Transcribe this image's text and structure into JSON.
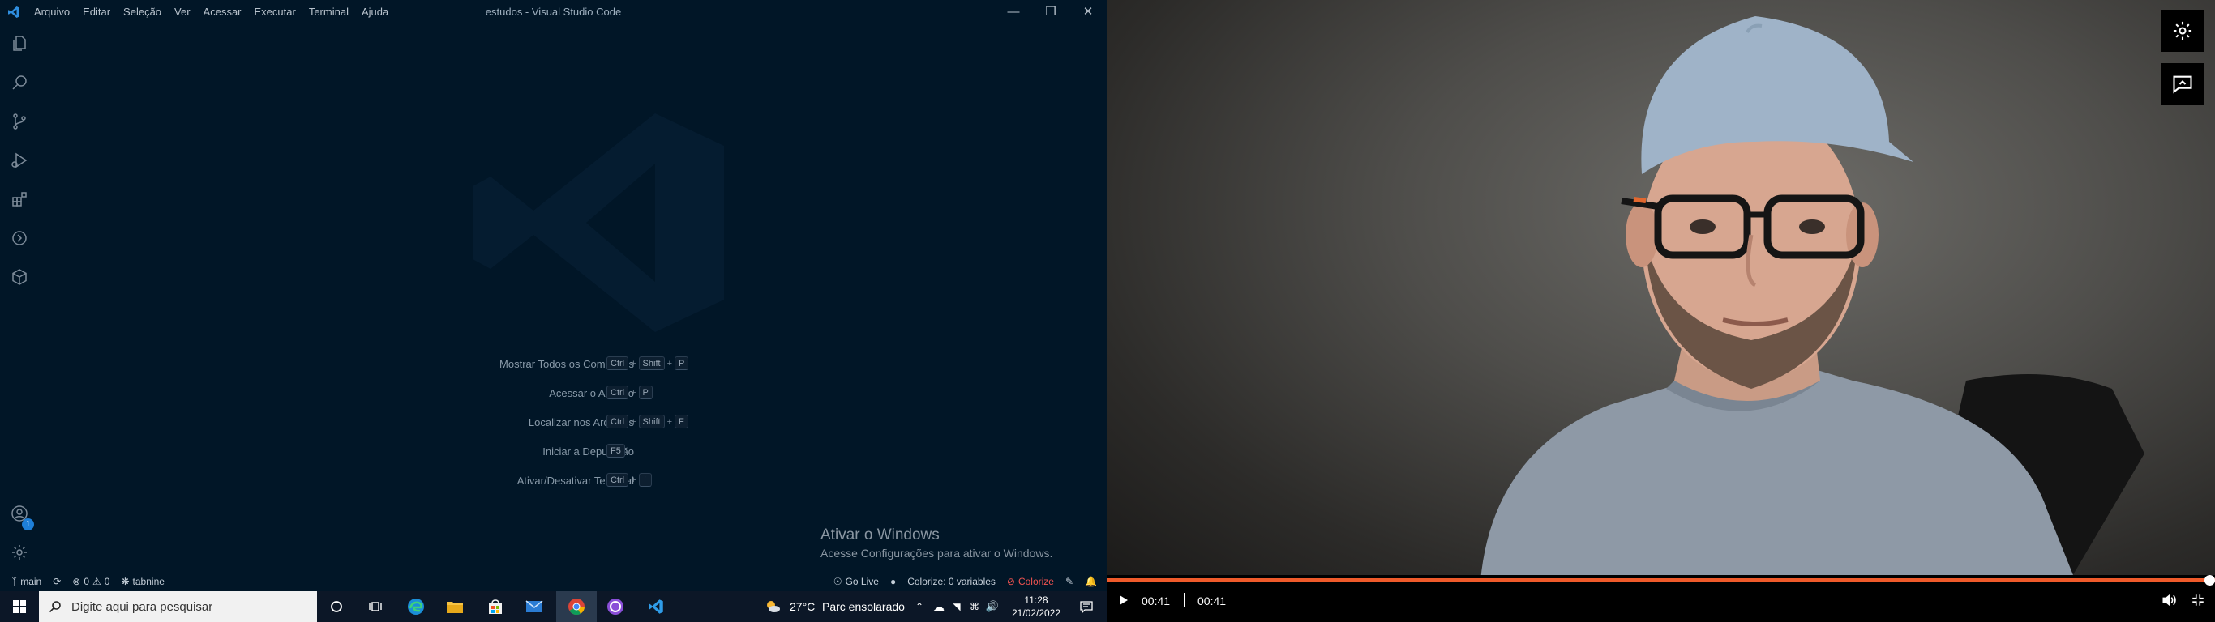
{
  "vscode": {
    "title_bar": {
      "menu": [
        "Arquivo",
        "Editar",
        "Seleção",
        "Ver",
        "Acessar",
        "Executar",
        "Terminal",
        "Ajuda"
      ],
      "window_title": "estudos - Visual Studio Code"
    },
    "activity_bar": {
      "icons": [
        "explorer-icon",
        "search-icon",
        "source-control-icon",
        "run-debug-icon",
        "extensions-icon",
        "remote-explorer-icon",
        "docker-icon",
        "account-icon",
        "settings-gear-icon"
      ],
      "account_badge": "1"
    },
    "shortcuts": [
      {
        "label": "Mostrar Todos os Comandos",
        "keys": [
          "Ctrl",
          "Shift",
          "P"
        ]
      },
      {
        "label": "Acessar o Arquivo",
        "keys": [
          "Ctrl",
          "P"
        ]
      },
      {
        "label": "Localizar nos Arquivos",
        "keys": [
          "Ctrl",
          "Shift",
          "F"
        ]
      },
      {
        "label": "Iniciar a Depuração",
        "keys": [
          "F5"
        ]
      },
      {
        "label": "Ativar/Desativar Terminal",
        "keys": [
          "Ctrl",
          "'"
        ]
      }
    ],
    "activation": {
      "title": "Ativar o Windows",
      "subtitle": "Acesse Configurações para ativar o Windows."
    },
    "status_bar": {
      "branch": "main",
      "errors": "0",
      "warnings": "0",
      "tabnine": "tabnine",
      "go_live": "Go Live",
      "colorize_vars": "Colorize: 0 variables",
      "colorize": "Colorize"
    }
  },
  "video": {
    "current_time": "00:41",
    "duration": "00:41",
    "progress_fraction": 1.0,
    "progress_color": "#ef5a2a"
  },
  "taskbar": {
    "search_placeholder": "Digite aqui para pesquisar",
    "apps": [
      "windows-start-icon",
      "cortana-icon",
      "task-view-icon",
      "edge-icon",
      "file-explorer-icon",
      "store-icon",
      "mail-icon",
      "chrome-icon",
      "github-desktop-icon",
      "vscode-icon"
    ],
    "weather_temp": "27°C",
    "weather_desc": "Parc ensolarado",
    "time": "11:28",
    "date": "21/02/2022"
  }
}
